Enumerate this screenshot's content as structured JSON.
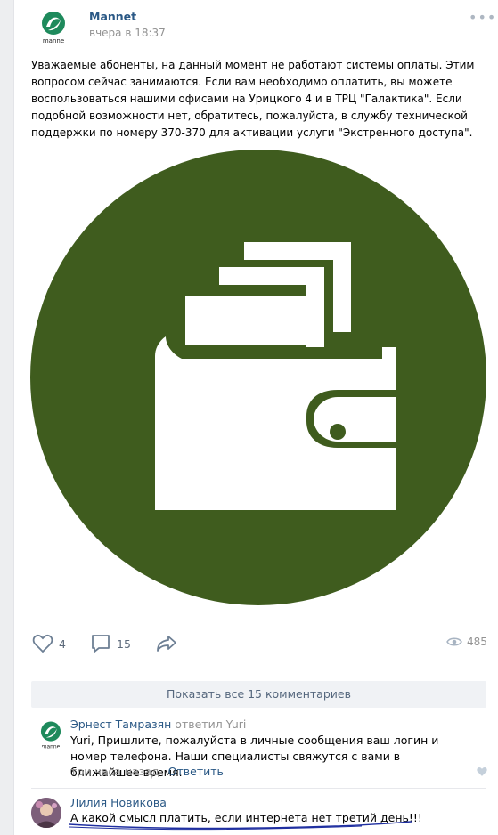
{
  "post": {
    "author": "Mannet",
    "logo_text": "manne",
    "date": "вчера в 18:37",
    "more": "•••",
    "text": "Уважаемые абоненты, на данный момент не работают системы оплаты. Этим вопросом сейчас занимаются. Если вам необходимо оплатить, вы можете воспользоваться нашими офисами на Урицкого 4 и в ТРЦ \"Галактика\". Если подобной возможности нет, обратитесь, пожалуйста, в службу технической поддержки по номеру 370-370 для активации услуги \"Экстренного доступа\".",
    "image_icon": "wallet-icon",
    "brand_color": "#3f5c1e"
  },
  "actions": {
    "likes": "4",
    "comments": "15",
    "views": "485"
  },
  "comments_block": {
    "show_all": "Показать все 15 комментариев",
    "items": [
      {
        "name": "Эрнест Тамразян",
        "replied": "ответил Yuri",
        "text": "Yuri, Пришлите, пожалуйста в личные сообщения ваш логин и номер телефона. Наши специалисты свяжутся с вами в ближайшее время.",
        "time": "три часа назад",
        "reply_label": "Ответить"
      },
      {
        "name": "Лилия Новикова",
        "text": "А какой смысл платить, если интернета нет третий день!!!"
      }
    ]
  }
}
